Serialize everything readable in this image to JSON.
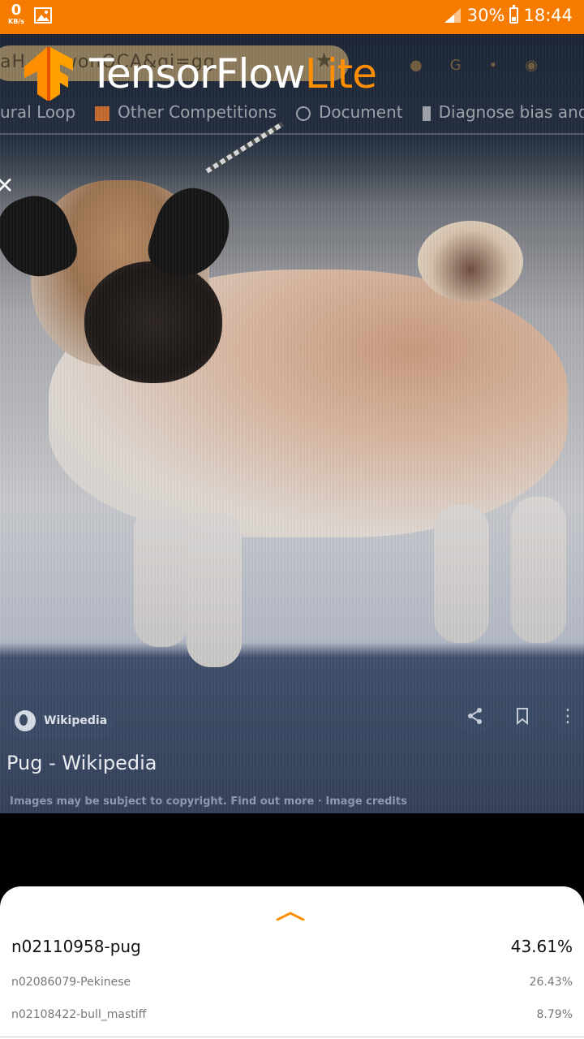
{
  "status_bar": {
    "net_speed_value": "0",
    "net_speed_unit": "KB/s",
    "battery_percent": "30%",
    "time": "18:44"
  },
  "background_browser": {
    "url_fragment": "aH     mawonOCA&gi=gg",
    "bookmarks": [
      "ural Loop",
      "Other Competitions",
      "Document",
      "Diagnose bias and..."
    ]
  },
  "logo": {
    "word_main": "TensorFlow",
    "word_accent": "Lite"
  },
  "photo_overlay": {
    "source_chip": "Wikipedia",
    "title": "Pug - Wikipedia",
    "note": "Images may be subject to copyright. Find out more · Image credits"
  },
  "results": {
    "items": [
      {
        "label": "n02110958-pug",
        "score": "43.61%"
      },
      {
        "label": "n02086079-Pekinese",
        "score": "26.43%"
      },
      {
        "label": "n02108422-bull_mastiff",
        "score": "8.79%"
      }
    ]
  },
  "colors": {
    "status_bar_bg": "#f57c00",
    "accent": "#ff8f00",
    "sheet_bg": "#ffffff"
  }
}
